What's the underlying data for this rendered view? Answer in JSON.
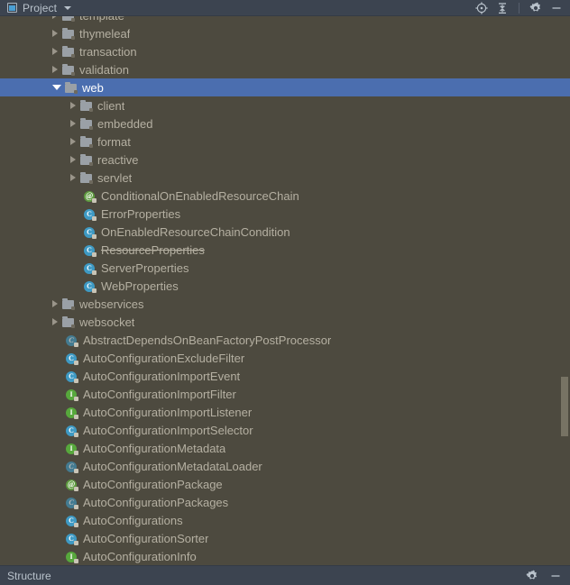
{
  "header": {
    "title": "Project",
    "project_icon": "project-window-icon",
    "dropdown_icon": "chevron-down-icon",
    "actions": [
      {
        "name": "select-opened-file-icon",
        "glyph": "crosshair"
      },
      {
        "name": "collapse-all-icon",
        "glyph": "collapse"
      },
      {
        "name": "settings-gear-icon",
        "glyph": "gear"
      },
      {
        "name": "hide-window-icon",
        "glyph": "minimize"
      }
    ]
  },
  "tree": {
    "selected_index": 4,
    "rows": [
      {
        "label": "template",
        "indent": 2,
        "kind": "folder",
        "state": "collapsed"
      },
      {
        "label": "thymeleaf",
        "indent": 2,
        "kind": "folder",
        "state": "collapsed"
      },
      {
        "label": "transaction",
        "indent": 2,
        "kind": "folder",
        "state": "collapsed"
      },
      {
        "label": "validation",
        "indent": 2,
        "kind": "folder",
        "state": "collapsed"
      },
      {
        "label": "web",
        "indent": 2,
        "kind": "folder",
        "state": "expanded",
        "selected": true
      },
      {
        "label": "client",
        "indent": 3,
        "kind": "folder",
        "state": "collapsed"
      },
      {
        "label": "embedded",
        "indent": 3,
        "kind": "folder",
        "state": "collapsed"
      },
      {
        "label": "format",
        "indent": 3,
        "kind": "folder",
        "state": "collapsed"
      },
      {
        "label": "reactive",
        "indent": 3,
        "kind": "folder",
        "state": "collapsed"
      },
      {
        "label": "servlet",
        "indent": 3,
        "kind": "folder",
        "state": "collapsed"
      },
      {
        "label": "ConditionalOnEnabledResourceChain",
        "indent": 3,
        "kind": "annotation",
        "state": "leaf"
      },
      {
        "label": "ErrorProperties",
        "indent": 3,
        "kind": "class",
        "state": "leaf"
      },
      {
        "label": "OnEnabledResourceChainCondition",
        "indent": 3,
        "kind": "class",
        "state": "leaf"
      },
      {
        "label": "ResourceProperties",
        "indent": 3,
        "kind": "class",
        "state": "leaf",
        "deprecated": true
      },
      {
        "label": "ServerProperties",
        "indent": 3,
        "kind": "class",
        "state": "leaf"
      },
      {
        "label": "WebProperties",
        "indent": 3,
        "kind": "class",
        "state": "leaf"
      },
      {
        "label": "webservices",
        "indent": 2,
        "kind": "folder",
        "state": "collapsed"
      },
      {
        "label": "websocket",
        "indent": 2,
        "kind": "folder",
        "state": "collapsed"
      },
      {
        "label": "AbstractDependsOnBeanFactoryPostProcessor",
        "indent": 2,
        "kind": "abstract-class",
        "state": "leaf"
      },
      {
        "label": "AutoConfigurationExcludeFilter",
        "indent": 2,
        "kind": "class",
        "state": "leaf"
      },
      {
        "label": "AutoConfigurationImportEvent",
        "indent": 2,
        "kind": "class",
        "state": "leaf"
      },
      {
        "label": "AutoConfigurationImportFilter",
        "indent": 2,
        "kind": "interface",
        "state": "leaf"
      },
      {
        "label": "AutoConfigurationImportListener",
        "indent": 2,
        "kind": "interface",
        "state": "leaf"
      },
      {
        "label": "AutoConfigurationImportSelector",
        "indent": 2,
        "kind": "class",
        "state": "leaf"
      },
      {
        "label": "AutoConfigurationMetadata",
        "indent": 2,
        "kind": "interface",
        "state": "leaf"
      },
      {
        "label": "AutoConfigurationMetadataLoader",
        "indent": 2,
        "kind": "abstract-class",
        "state": "leaf"
      },
      {
        "label": "AutoConfigurationPackage",
        "indent": 2,
        "kind": "annotation",
        "state": "leaf"
      },
      {
        "label": "AutoConfigurationPackages",
        "indent": 2,
        "kind": "abstract-class",
        "state": "leaf"
      },
      {
        "label": "AutoConfigurations",
        "indent": 2,
        "kind": "class",
        "state": "leaf"
      },
      {
        "label": "AutoConfigurationSorter",
        "indent": 2,
        "kind": "class",
        "state": "leaf"
      },
      {
        "label": "AutoConfigurationInfo",
        "indent": 2,
        "kind": "interface",
        "state": "leaf"
      }
    ]
  },
  "statusbar": {
    "label": "Structure",
    "actions": [
      {
        "name": "settings-gear-icon",
        "glyph": "gear"
      },
      {
        "name": "hide-window-icon",
        "glyph": "minimize"
      }
    ]
  },
  "colors": {
    "header_bg": "#3c4450",
    "tree_bg": "#4d4a3f",
    "selection": "#4b6eaf",
    "text": "#b5b0a2",
    "header_text": "#b9c2cb",
    "class_icon": "#3e9ac4",
    "interface_icon": "#57a83c",
    "annotation_icon": "#5e9b3f"
  }
}
